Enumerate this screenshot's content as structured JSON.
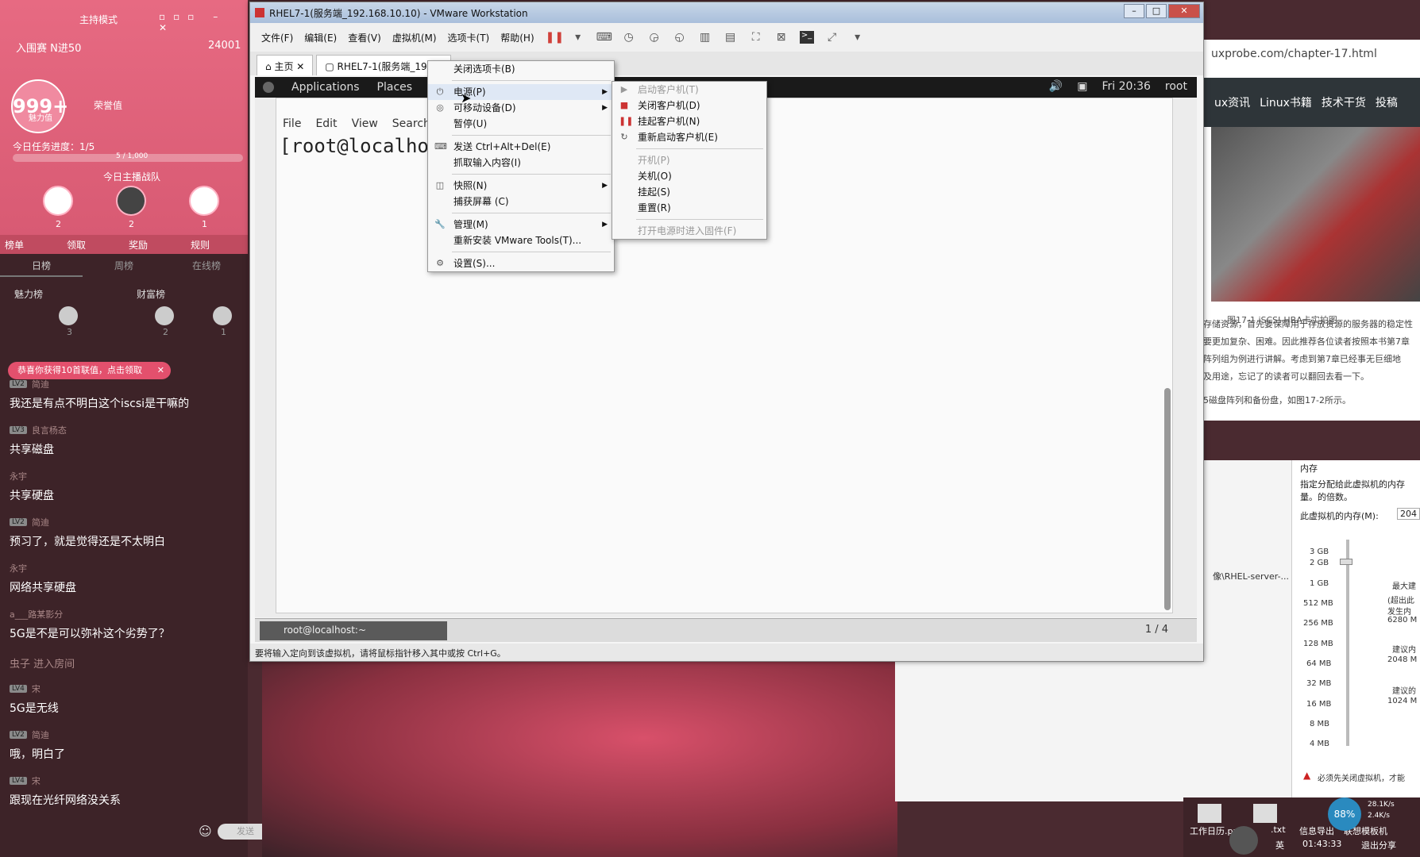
{
  "left_panel": {
    "host_mode": "主持模式",
    "room_label": "入围赛 N进50",
    "room_count": "24001",
    "score": "999+",
    "score_sub": "魅力值",
    "honor_label": "荣誉值",
    "task_progress": "今日任务进度：1/5",
    "task_bar": "5 / 1,000",
    "team_label": "今日主播战队",
    "team_nums": [
      "2",
      "2",
      "1"
    ],
    "tabs": [
      "榜单",
      "领取",
      "奖励",
      "规则"
    ],
    "sub_tabs": [
      "日榜",
      "周榜",
      "在线榜"
    ],
    "charm_label": "魅力榜",
    "wealth_label": "财富榜",
    "lb_nums": [
      "3",
      "2",
      "1"
    ],
    "notice": "恭喜你获得10首联值，点击领取",
    "messages": [
      {
        "lv": "LV2",
        "user": "简迪",
        "text": "我还是有点不明白这个iscsi是干嘛的"
      },
      {
        "lv": "LV3",
        "user": "良言杨态",
        "text": "共享磁盘"
      },
      {
        "lv": "",
        "user": "永宇",
        "text": "共享硬盘"
      },
      {
        "lv": "LV2",
        "user": "简迪",
        "text": "预习了，就是觉得还是不太明白"
      },
      {
        "lv": "",
        "user": "永宇",
        "text": "网络共享硬盘"
      },
      {
        "lv": "",
        "user": "a___路某影分",
        "text": "5G是不是可以弥补这个劣势了？"
      },
      {
        "lv": "",
        "user": "虫子 进入房间",
        "text": ""
      },
      {
        "lv": "LV4",
        "user": "宋",
        "text": "5G是无线"
      },
      {
        "lv": "LV2",
        "user": "简迪",
        "text": "哦，明白了"
      },
      {
        "lv": "LV4",
        "user": "宋",
        "text": "跟现在光纤网络没关系"
      }
    ],
    "input_placeholder": "发送"
  },
  "vmware": {
    "title": "RHEL7-1(服务端_192.168.10.10) - VMware Workstation",
    "menus": [
      "文件(F)",
      "编辑(E)",
      "查看(V)",
      "虚拟机(M)",
      "选项卡(T)",
      "帮助(H)"
    ],
    "tabs": [
      "主页",
      "RHEL7-1(服务端_192.1"
    ],
    "gnome": {
      "apps": "Applications",
      "places": "Places",
      "clock": "Fri 20:36",
      "user": "root"
    },
    "terminal": {
      "menu": [
        "File",
        "Edit",
        "View",
        "Search",
        "Te"
      ],
      "prompt": "[root@localhost"
    },
    "guest_task": "root@localhost:~",
    "pages": "1 / 4",
    "status": "要将输入定向到该虚拟机，请将鼠标指针移入其中或按 Ctrl+G。"
  },
  "context_menu": {
    "items": [
      {
        "label": "关闭选项卡(B)",
        "icon": "",
        "sub": false
      },
      {
        "label": "电源(P)",
        "icon": "power-icon",
        "sub": true
      },
      {
        "label": "可移动设备(D)",
        "icon": "device-icon",
        "sub": true
      },
      {
        "label": "暂停(U)",
        "icon": "",
        "sub": false
      },
      {
        "label": "发送 Ctrl+Alt+Del(E)",
        "icon": "keyboard-icon",
        "sub": false
      },
      {
        "label": "抓取输入内容(I)",
        "icon": "",
        "sub": false
      },
      {
        "label": "快照(N)",
        "icon": "snapshot-icon",
        "sub": true
      },
      {
        "label": "捕获屏幕 (C)",
        "icon": "",
        "sub": false
      },
      {
        "label": "管理(M)",
        "icon": "wrench-icon",
        "sub": true
      },
      {
        "label": "重新安装 VMware Tools(T)...",
        "icon": "",
        "sub": false
      },
      {
        "label": "设置(S)...",
        "icon": "settings-icon",
        "sub": false
      }
    ]
  },
  "power_menu": {
    "items": [
      {
        "label": "启动客户机(T)",
        "disabled": true
      },
      {
        "label": "关闭客户机(D)",
        "disabled": false
      },
      {
        "label": "挂起客户机(N)",
        "disabled": false
      },
      {
        "label": "重新启动客户机(E)",
        "disabled": false
      },
      {
        "label": "开机(P)",
        "disabled": true
      },
      {
        "label": "关机(O)",
        "disabled": false
      },
      {
        "label": "挂起(S)",
        "disabled": false
      },
      {
        "label": "重置(R)",
        "disabled": false
      },
      {
        "label": "打开电源时进入固件(F)",
        "disabled": true
      }
    ]
  },
  "browser": {
    "url": "uxprobe.com/chapter-17.html",
    "nav": [
      "ux资讯",
      "Linux书籍",
      "技术干货",
      "投稿"
    ],
    "caption": "图17-1  iSCSI-HBA卡实拍图",
    "lines": [
      "存储资源，首先要保障用于存放资源的服务器的稳定性",
      "要更加复杂、困难。因此推荐各位读者按照本书第7章",
      "阵列组为例进行讲解。考虑到第7章已经事无巨细地",
      "及用途，忘记了的读者可以翻回去看一下。",
      "5磁盘阵列和备份盘，如图17-2所示。"
    ]
  },
  "vm_settings": {
    "iso": "像\\RHEL-server-...",
    "mem_title": "内存",
    "mem_desc": "指定分配给此虚拟机的内存量。的倍数。",
    "mem_field": "此虚拟机的内存(M):",
    "mem_value": "204",
    "ticks": [
      "3 GB",
      "2 GB",
      "1 GB",
      "512 MB",
      "256 MB",
      "128 MB",
      "64 MB",
      "32 MB",
      "16 MB",
      "8 MB",
      "4 MB"
    ],
    "legend": [
      "最大建",
      "(超出此",
      "发生内",
      "6280 M",
      "建议内",
      "2048 M",
      "建议的",
      "1024 M"
    ],
    "warning": "必须先关闭虚拟机，才能"
  },
  "taskbar": {
    "file1": "工作日历.png",
    "file2": ".txt",
    "file3": "信息导出",
    "file4": "联想模板机",
    "battery": "88%",
    "up": "28.1K/s",
    "down": "2.4K/s",
    "time": "01:43:33",
    "exit_share": "退出分享",
    "ime": "英"
  }
}
